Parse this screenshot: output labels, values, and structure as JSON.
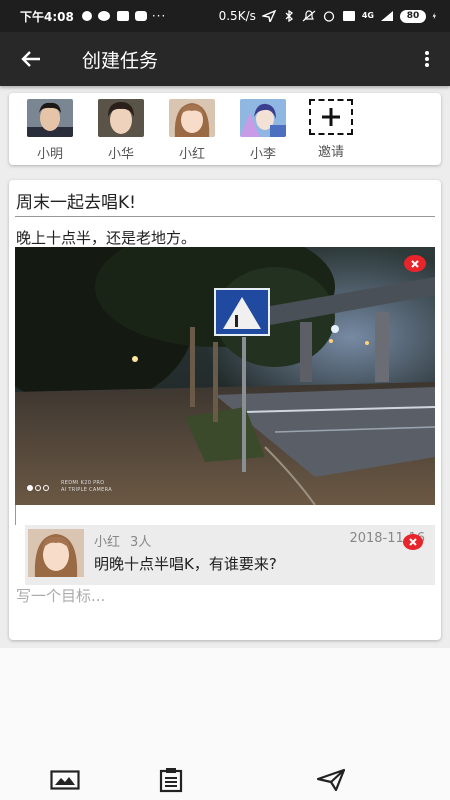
{
  "status_bar": {
    "time": "下午4:08",
    "network_speed": "0.5K/s",
    "signal": "4G",
    "battery": "80"
  },
  "app_bar": {
    "title": "创建任务",
    "back_icon": "arrow-left-icon",
    "menu_icon": "more-vert-icon"
  },
  "participants": [
    {
      "name": "小明",
      "icon": "avatar"
    },
    {
      "name": "小华",
      "icon": "avatar"
    },
    {
      "name": "小红",
      "icon": "avatar"
    },
    {
      "name": "小李",
      "icon": "avatar"
    },
    {
      "name": "邀请",
      "icon": "add-box-icon"
    }
  ],
  "task": {
    "title": "周末一起去唱K!",
    "description": "晚上十点半，还是老地方。",
    "photo_watermark": [
      "REDMI K20 PRO",
      "AI TRIPLE CAMERA"
    ],
    "post": {
      "author": "小红",
      "count": "3人",
      "date": "2018-11-16",
      "text": "明晚十点半唱K，有谁要来?"
    },
    "goal_placeholder": "写一个目标..."
  },
  "bottom_bar": {
    "icons": [
      "image-icon",
      "clipboard-icon",
      "send-icon"
    ]
  },
  "colors": {
    "app_bar": "#282828",
    "status_bar": "#1e1e1e",
    "delete": "#e8252b"
  }
}
